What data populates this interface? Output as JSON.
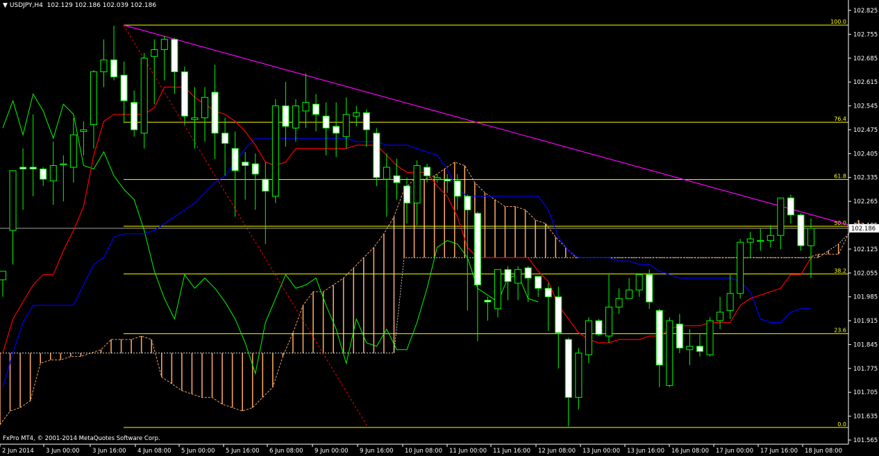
{
  "header": {
    "symbol": "USDJPY,H4",
    "ohlc": "102.129 102.186 102.039 102.186"
  },
  "copyright": "FxPro MT4, © 2001-2014 MetaQuotes Software Corp.",
  "colors": {
    "background": "#000000",
    "bull": "#00ff00",
    "bear_body": "#ffffff",
    "kumo": "#f4a460",
    "tenkan": "#ff0000",
    "kijun": "#0000ff",
    "chikou": "#00ff00",
    "fibo": "#ffff00",
    "trendline": "#ff00ff"
  },
  "chart_data": {
    "type": "candlestick",
    "symbol": "USDJPY",
    "timeframe": "H4",
    "ylim": [
      101.565,
      102.825
    ],
    "y_ticks": [
      "102.825",
      "102.755",
      "102.685",
      "102.615",
      "102.545",
      "102.475",
      "102.405",
      "102.335",
      "102.265",
      "102.195",
      "102.125",
      "102.055",
      "101.985",
      "101.915",
      "101.845",
      "101.775",
      "101.705",
      "101.635",
      "101.565"
    ],
    "x_ticks": [
      "2 Jun 2014",
      "3 Jun 00:00",
      "3 Jun 16:00",
      "4 Jun 08:00",
      "5 Jun 00:00",
      "5 Jun 16:00",
      "6 Jun 08:00",
      "9 Jun 00:00",
      "9 Jun 16:00",
      "10 Jun 08:00",
      "11 Jun 00:00",
      "11 Jun 16:00",
      "12 Jun 08:00",
      "13 Jun 00:00",
      "13 Jun 16:00",
      "16 Jun 08:00",
      "17 Jun 00:00",
      "17 Jun 16:00",
      "18 Jun 08:00"
    ],
    "current_price": "102.186",
    "fibonacci": {
      "levels": [
        {
          "label": "100.0",
          "price": 102.782
        },
        {
          "label": "76.4",
          "price": 102.497
        },
        {
          "label": "61.8",
          "price": 102.329
        },
        {
          "label": "50.0",
          "price": 102.192
        },
        {
          "label": "38.2",
          "price": 102.052
        },
        {
          "label": "23.6",
          "price": 101.877
        },
        {
          "label": "0.0",
          "price": 101.602
        }
      ]
    },
    "candles": [
      [
        102.035,
        102.045,
        101.985,
        102.06
      ],
      [
        102.18,
        102.355,
        102.08,
        102.355
      ],
      [
        102.365,
        102.42,
        102.24,
        102.36
      ],
      [
        102.365,
        102.52,
        102.28,
        102.36
      ],
      [
        102.36,
        102.365,
        102.31,
        102.33
      ],
      [
        102.325,
        102.44,
        102.255,
        102.37
      ],
      [
        102.375,
        102.4,
        102.265,
        102.375
      ],
      [
        102.365,
        102.51,
        102.32,
        102.46
      ],
      [
        102.47,
        102.5,
        102.4,
        102.475
      ],
      [
        102.49,
        102.65,
        102.42,
        102.645
      ],
      [
        102.645,
        102.74,
        102.6,
        102.68
      ],
      [
        102.68,
        102.78,
        102.62,
        102.63
      ],
      [
        102.635,
        102.675,
        102.495,
        102.56
      ],
      [
        102.555,
        102.59,
        102.455,
        102.475
      ],
      [
        102.465,
        102.7,
        102.42,
        102.685
      ],
      [
        102.69,
        102.74,
        102.55,
        102.71
      ],
      [
        102.71,
        102.75,
        102.62,
        102.74
      ],
      [
        102.74,
        102.745,
        102.58,
        102.645
      ],
      [
        102.645,
        102.66,
        102.49,
        102.515
      ],
      [
        102.505,
        102.6,
        102.42,
        102.51
      ],
      [
        102.51,
        102.6,
        102.44,
        102.57
      ],
      [
        102.585,
        102.665,
        102.39,
        102.465
      ],
      [
        102.465,
        102.51,
        102.34,
        102.435
      ],
      [
        102.42,
        102.47,
        102.22,
        102.355
      ],
      [
        102.38,
        102.41,
        102.27,
        102.37
      ],
      [
        102.375,
        102.405,
        102.24,
        102.345
      ],
      [
        102.33,
        102.38,
        102.14,
        102.295
      ],
      [
        102.28,
        102.565,
        102.26,
        102.545
      ],
      [
        102.545,
        102.615,
        102.425,
        102.485
      ],
      [
        102.48,
        102.565,
        102.44,
        102.545
      ],
      [
        102.53,
        102.64,
        102.48,
        102.555
      ],
      [
        102.55,
        102.58,
        102.47,
        102.52
      ],
      [
        102.515,
        102.555,
        102.4,
        102.48
      ],
      [
        102.485,
        102.555,
        102.395,
        102.465
      ],
      [
        102.455,
        102.57,
        102.42,
        102.52
      ],
      [
        102.515,
        102.545,
        102.485,
        102.525
      ],
      [
        102.525,
        102.535,
        102.425,
        102.475
      ],
      [
        102.465,
        102.48,
        102.31,
        102.335
      ],
      [
        102.33,
        102.405,
        102.22,
        102.365
      ],
      [
        102.34,
        102.39,
        102.27,
        102.32
      ],
      [
        102.31,
        102.335,
        102.2,
        102.26
      ],
      [
        102.26,
        102.385,
        102.195,
        102.37
      ],
      [
        102.365,
        102.375,
        102.32,
        102.34
      ],
      [
        102.33,
        102.345,
        102.32,
        102.335
      ],
      [
        102.33,
        102.345,
        102.29,
        102.325
      ],
      [
        102.325,
        102.345,
        102.24,
        102.28
      ],
      [
        102.28,
        102.285,
        101.945,
        102.24
      ],
      [
        102.23,
        102.235,
        101.855,
        102.02
      ],
      [
        101.975,
        101.985,
        101.915,
        101.97
      ],
      [
        101.95,
        102.055,
        101.925,
        102.065
      ],
      [
        102.065,
        102.075,
        101.975,
        102.03
      ],
      [
        102.025,
        102.075,
        101.975,
        102.065
      ],
      [
        102.07,
        102.075,
        101.97,
        102.04
      ],
      [
        102.045,
        102.045,
        101.985,
        102.01
      ],
      [
        102.01,
        102.025,
        101.885,
        101.985
      ],
      [
        101.985,
        102.015,
        101.775,
        101.88
      ],
      [
        101.86,
        101.865,
        101.605,
        101.69
      ],
      [
        101.69,
        101.835,
        101.655,
        101.82
      ],
      [
        101.815,
        101.925,
        101.79,
        101.915
      ],
      [
        101.915,
        101.92,
        101.87,
        101.875
      ],
      [
        101.87,
        102.05,
        101.85,
        101.955
      ],
      [
        101.955,
        102.01,
        101.935,
        101.98
      ],
      [
        101.98,
        102.04,
        101.99,
        102.005
      ],
      [
        102.005,
        102.045,
        101.985,
        102.05
      ],
      [
        102.05,
        102.065,
        101.95,
        101.97
      ],
      [
        101.945,
        101.95,
        101.72,
        101.785
      ],
      [
        101.725,
        101.925,
        101.72,
        101.915
      ],
      [
        101.905,
        101.935,
        101.82,
        101.835
      ],
      [
        101.83,
        101.89,
        101.785,
        101.84
      ],
      [
        101.84,
        101.875,
        101.81,
        101.825
      ],
      [
        101.815,
        101.925,
        101.81,
        101.915
      ],
      [
        101.915,
        101.985,
        101.89,
        101.94
      ],
      [
        101.945,
        102.05,
        101.92,
        101.995
      ],
      [
        101.995,
        102.155,
        101.98,
        102.145
      ],
      [
        102.145,
        102.175,
        102.1,
        102.155
      ],
      [
        102.15,
        102.185,
        102.12,
        102.15
      ],
      [
        102.15,
        102.195,
        102.13,
        102.165
      ],
      [
        102.165,
        102.27,
        102.125,
        102.275
      ],
      [
        102.275,
        102.285,
        102.2,
        102.225
      ],
      [
        102.225,
        102.23,
        102.12,
        102.135
      ],
      [
        102.135,
        102.215,
        102.04,
        102.186
      ]
    ],
    "tenkan": [
      101.82,
      101.92,
      101.97,
      102.02,
      102.05,
      102.05,
      102.12,
      102.18,
      102.25,
      102.4,
      102.5,
      102.52,
      102.52,
      102.52,
      102.52,
      102.54,
      102.6,
      102.6,
      102.6,
      102.57,
      102.55,
      102.53,
      102.52,
      102.5,
      102.47,
      102.43,
      102.38,
      102.37,
      102.38,
      102.42,
      102.42,
      102.42,
      102.42,
      102.42,
      102.42,
      102.43,
      102.43,
      102.43,
      102.4,
      102.37,
      102.35,
      102.35,
      102.35,
      102.31,
      102.28,
      102.22,
      102.13,
      102.1,
      102.1,
      102.1,
      102.1,
      102.1,
      102.1,
      102.06,
      102.03,
      101.96,
      101.92,
      101.88,
      101.86,
      101.85,
      101.85,
      101.86,
      101.86,
      101.86,
      101.87,
      101.87,
      101.89,
      101.9,
      101.9,
      101.9,
      101.91,
      101.91,
      101.91,
      101.96,
      101.98,
      101.99,
      102.0,
      102.01,
      102.05,
      102.05,
      102.1
    ],
    "kijun": [
      101.72,
      101.82,
      101.91,
      101.96,
      101.96,
      101.96,
      101.96,
      101.96,
      102.02,
      102.08,
      102.1,
      102.16,
      102.17,
      102.17,
      102.17,
      102.18,
      102.2,
      102.22,
      102.24,
      102.26,
      102.29,
      102.32,
      102.34,
      102.38,
      102.42,
      102.45,
      102.45,
      102.45,
      102.45,
      102.45,
      102.45,
      102.45,
      102.45,
      102.45,
      102.45,
      102.44,
      102.44,
      102.44,
      102.43,
      102.43,
      102.43,
      102.42,
      102.41,
      102.4,
      102.36,
      102.3,
      102.28,
      102.28,
      102.28,
      102.28,
      102.28,
      102.28,
      102.28,
      102.28,
      102.24,
      102.16,
      102.12,
      102.1,
      102.1,
      102.1,
      102.1,
      102.09,
      102.09,
      102.08,
      102.08,
      102.06,
      102.05,
      102.04,
      102.04,
      102.04,
      102.04,
      102.04,
      102.04,
      102.03,
      102.0,
      101.92,
      101.91,
      101.91,
      101.94,
      101.95,
      101.95
    ],
    "chikou": [
      102.48,
      102.56,
      102.46,
      102.58,
      102.53,
      102.45,
      102.55,
      102.52,
      102.37,
      102.36,
      102.41,
      102.34,
      102.3,
      102.27,
      102.18,
      102.06,
      101.98,
      101.92,
      102.05,
      102.01,
      102.04,
      102.01,
      101.97,
      101.92,
      101.85,
      101.76,
      101.91,
      101.98,
      102.05,
      102.01,
      102.02,
      102.04,
      101.96,
      101.89,
      101.79,
      101.92,
      101.85,
      101.84,
      101.89,
      101.83,
      101.83,
      101.91,
      102.01,
      102.13,
      102.15,
      102.14,
      102.1,
      102.01,
      101.99,
      101.97,
      102.04,
      102.05,
      101.98,
      101.97
    ],
    "senkou_a": [
      101.61,
      101.65,
      101.66,
      101.68,
      101.79,
      101.8,
      101.8,
      101.81,
      101.81,
      101.82,
      101.83,
      101.86,
      101.86,
      101.86,
      101.87,
      101.86,
      101.75,
      101.73,
      101.71,
      101.7,
      101.69,
      101.69,
      101.67,
      101.66,
      101.65,
      101.66,
      101.69,
      101.72,
      101.81,
      101.88,
      101.96,
      102.0,
      102.0,
      102.02,
      102.04,
      102.07,
      102.1,
      102.13,
      102.17,
      102.22,
      102.3,
      102.33,
      102.33,
      102.34,
      102.36,
      102.38,
      102.37,
      102.32,
      102.29,
      102.27,
      102.25,
      102.25,
      102.24,
      102.21,
      102.2,
      102.16,
      102.13,
      102.1,
      102.1,
      102.1,
      102.1,
      102.1,
      102.1,
      102.1,
      102.1,
      102.1,
      102.1,
      102.1,
      102.1,
      102.1,
      102.1,
      102.1,
      102.1,
      102.1,
      102.1,
      102.1,
      102.1,
      102.1,
      102.1,
      102.1,
      102.1,
      102.11,
      102.11,
      102.11,
      102.17,
      102.2
    ],
    "senkou_b": [
      101.82,
      101.82,
      101.82,
      101.82,
      101.82,
      101.82,
      101.82,
      101.82,
      101.82,
      101.82,
      101.82,
      101.82,
      101.82,
      101.82,
      101.82,
      101.82,
      101.82,
      101.82,
      101.82,
      101.82,
      101.82,
      101.82,
      101.82,
      101.82,
      101.82,
      101.82,
      101.82,
      101.82,
      101.82,
      101.82,
      101.82,
      101.82,
      101.82,
      101.82,
      101.82,
      101.82,
      101.82,
      101.82,
      101.82,
      101.82,
      102.1,
      102.1,
      102.1,
      102.1,
      102.1,
      102.1,
      102.1,
      102.1,
      102.1,
      102.1,
      102.1,
      102.1,
      102.1,
      102.1,
      102.1,
      102.1,
      102.1,
      102.1,
      102.1,
      102.1,
      102.1,
      102.1,
      102.1,
      102.1,
      102.1,
      102.1,
      102.1,
      102.1,
      102.1,
      102.1,
      102.1,
      102.1,
      102.1,
      102.1,
      102.1,
      102.1,
      102.1,
      102.1,
      102.1,
      102.1,
      102.1,
      102.1,
      102.12,
      102.14,
      102.17,
      102.21
    ],
    "trendline": {
      "from": [
        102.782
      ],
      "to": [
        102.196
      ]
    }
  }
}
